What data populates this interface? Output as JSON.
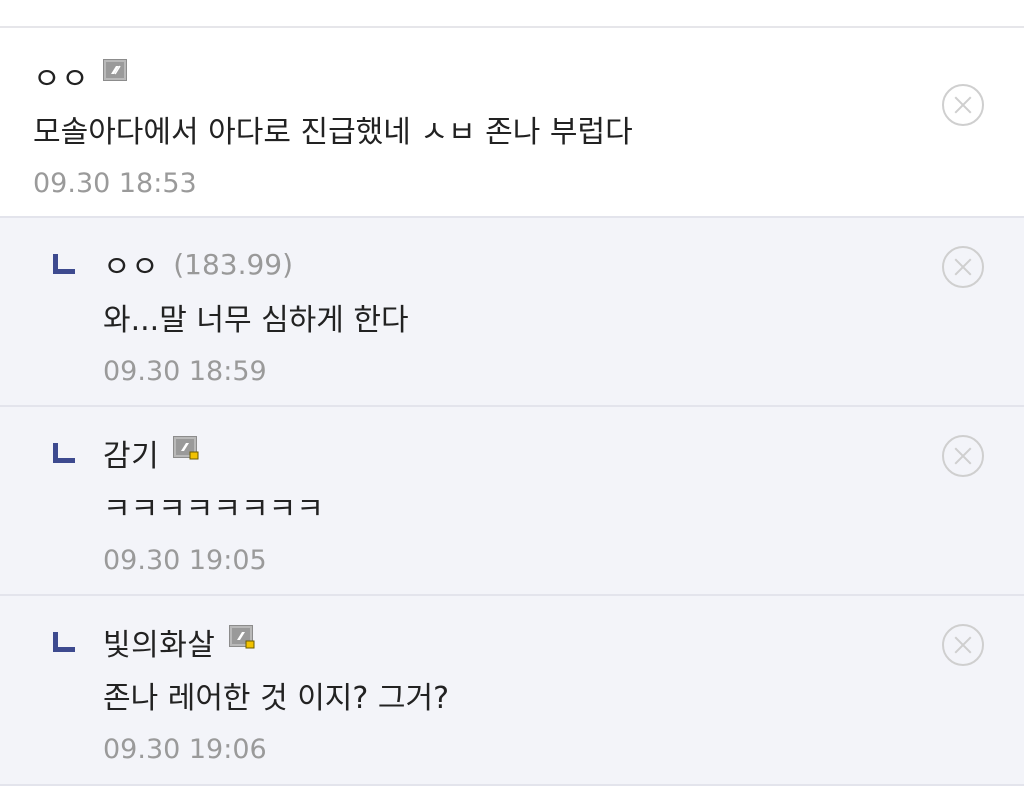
{
  "icons": {
    "fixed_nick_badge": "fixed-nickname-icon",
    "sub_manager_badge": "semi-fixed-nickname-icon",
    "reply_indicator": "reply-arrow-icon",
    "delete": "delete-circle-x-icon"
  },
  "colors": {
    "reply_arrow": "#3d4a8f",
    "reply_bg": "#f3f4f9",
    "time_text": "#9a9a9a"
  },
  "comments": [
    {
      "nickname": "ㅇㅇ",
      "text": "모솔아다에서 아다로 진급했네 ㅅㅂ 존나 부럽다",
      "time": "09.30 18:53"
    },
    {
      "nickname": "ㅇㅇ",
      "ip": "(183.99)",
      "text": "와...말 너무 심하게 한다",
      "time": "09.30 18:59"
    },
    {
      "nickname": "감기",
      "text": "ㅋㅋㅋㅋㅋㅋㅋㅋ",
      "time": "09.30 19:05"
    },
    {
      "nickname": "빛의화살",
      "text": "존나 레어한 것 이지? 그거?",
      "time": "09.30 19:06"
    }
  ]
}
